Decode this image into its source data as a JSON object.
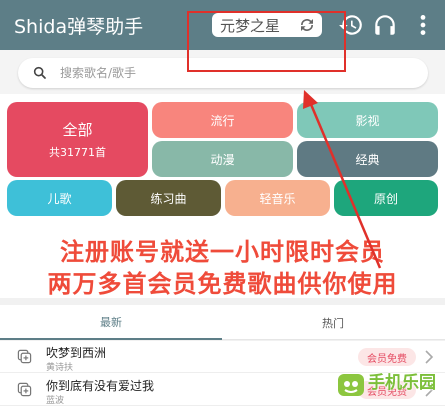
{
  "appbar": {
    "title": "Shida弹琴助手",
    "server_chip": "元梦之星",
    "accent": "#5d7e87"
  },
  "search": {
    "placeholder": "搜索歌名/歌手"
  },
  "categories": {
    "all": {
      "label": "全部",
      "count_text": "共31771首",
      "color": "#e54a61"
    },
    "items": [
      {
        "label": "流行",
        "color": "#f8857d"
      },
      {
        "label": "影视",
        "color": "#7fc8b8"
      },
      {
        "label": "动漫",
        "color": "#88b8a8"
      },
      {
        "label": "经典",
        "color": "#5f7a83"
      },
      {
        "label": "儿歌",
        "color": "#3ec0d8"
      },
      {
        "label": "练习曲",
        "color": "#5e5a35"
      },
      {
        "label": "轻音乐",
        "color": "#f7b08f"
      },
      {
        "label": "原创",
        "color": "#1ea67c"
      }
    ]
  },
  "banner": {
    "line1": "注册账号就送一小时限时会员",
    "line2": "两万多首会员免费歌曲供你使用"
  },
  "tabs": [
    {
      "label": "最新"
    },
    {
      "label": "热门"
    }
  ],
  "songs": [
    {
      "title": "吹梦到西洲",
      "artist": "黄诗扶",
      "badge": "会员免费"
    },
    {
      "title": "你到底有没有爱过我",
      "artist": "蓝波",
      "badge": "会员免费"
    }
  ],
  "watermark": {
    "text": "手机乐园"
  },
  "icons": [
    "refresh-icon",
    "history-icon",
    "headphones-icon",
    "more-vert-icon",
    "search-icon",
    "song-icon",
    "chevron-right-icon",
    "arrow-annotation"
  ]
}
